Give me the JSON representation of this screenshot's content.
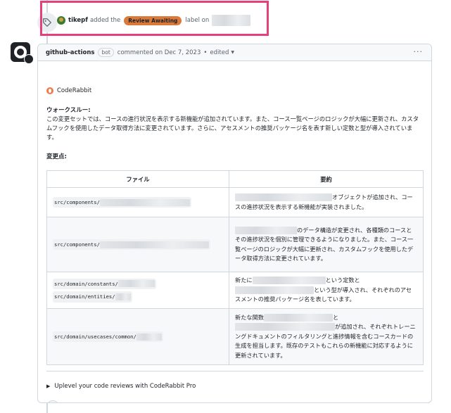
{
  "event": {
    "user": "tikepf",
    "action_text": "added the",
    "label": "Review Awaiting",
    "label_color": "#d9793a",
    "suffix_text": "label on",
    "highlight_color": "#e5407a",
    "icon": "tag-icon"
  },
  "comment": {
    "author": "github-actions",
    "bot_badge": "bot",
    "meta": "commented on Dec 7, 2023",
    "separator": "•",
    "edited": "edited",
    "more": "···"
  },
  "body": {
    "coderabbit": "CodeRabbit",
    "walkthrough_title": "ウォークスルー:",
    "walkthrough_text": "この変更セットでは、コースの進行状況を表示する新機能が追加されています。また、コース一覧ページのロジックが大幅に更新され、カスタムフックを使用したデータ取得方法に変更されています。さらに、アセスメントの推奨パッケージ名を表す新しい定数と型が導入されています。",
    "changes_title": "変更点:",
    "table": {
      "headers": [
        "ファイル",
        "要約"
      ],
      "rows": [
        {
          "files": [
            "src/components/"
          ],
          "summary_a": "オブジェクトが追加され、コースの進捗状況を表示する新機能が実装されました。",
          "summary_b": ""
        },
        {
          "files": [
            "src/components/"
          ],
          "summary_a": "のデータ構造が変更され、各種類のコースとその進捗状況を個別に管理できるようになりました。また、コース一覧ページのロジックが大幅に更新され、カスタムフックを使用したデータ取得方法に変更されています。",
          "summary_b": ""
        },
        {
          "files": [
            "src/domain/constants/",
            "src/domain/entities/"
          ],
          "summary_a": "新たに",
          "summary_b": "という定数と",
          "summary_c": "という型が導入され、それぞれのアセスメントの推奨パッケージ名を表しています。"
        },
        {
          "files": [
            "src/domain/usecases/common/"
          ],
          "summary_a": "新たな関数",
          "summary_b": "と",
          "summary_c": "が追加され、それぞれトレーニングドキュメントのフィルタリングと進捗情報を含むコースカードの生成を担当します。既存のテストもこれらの新機能に対応するように更新されています。"
        }
      ]
    },
    "details_summary": "Uplevel your code reviews with CodeRabbit Pro",
    "reaction_icon": "smiley-icon"
  }
}
